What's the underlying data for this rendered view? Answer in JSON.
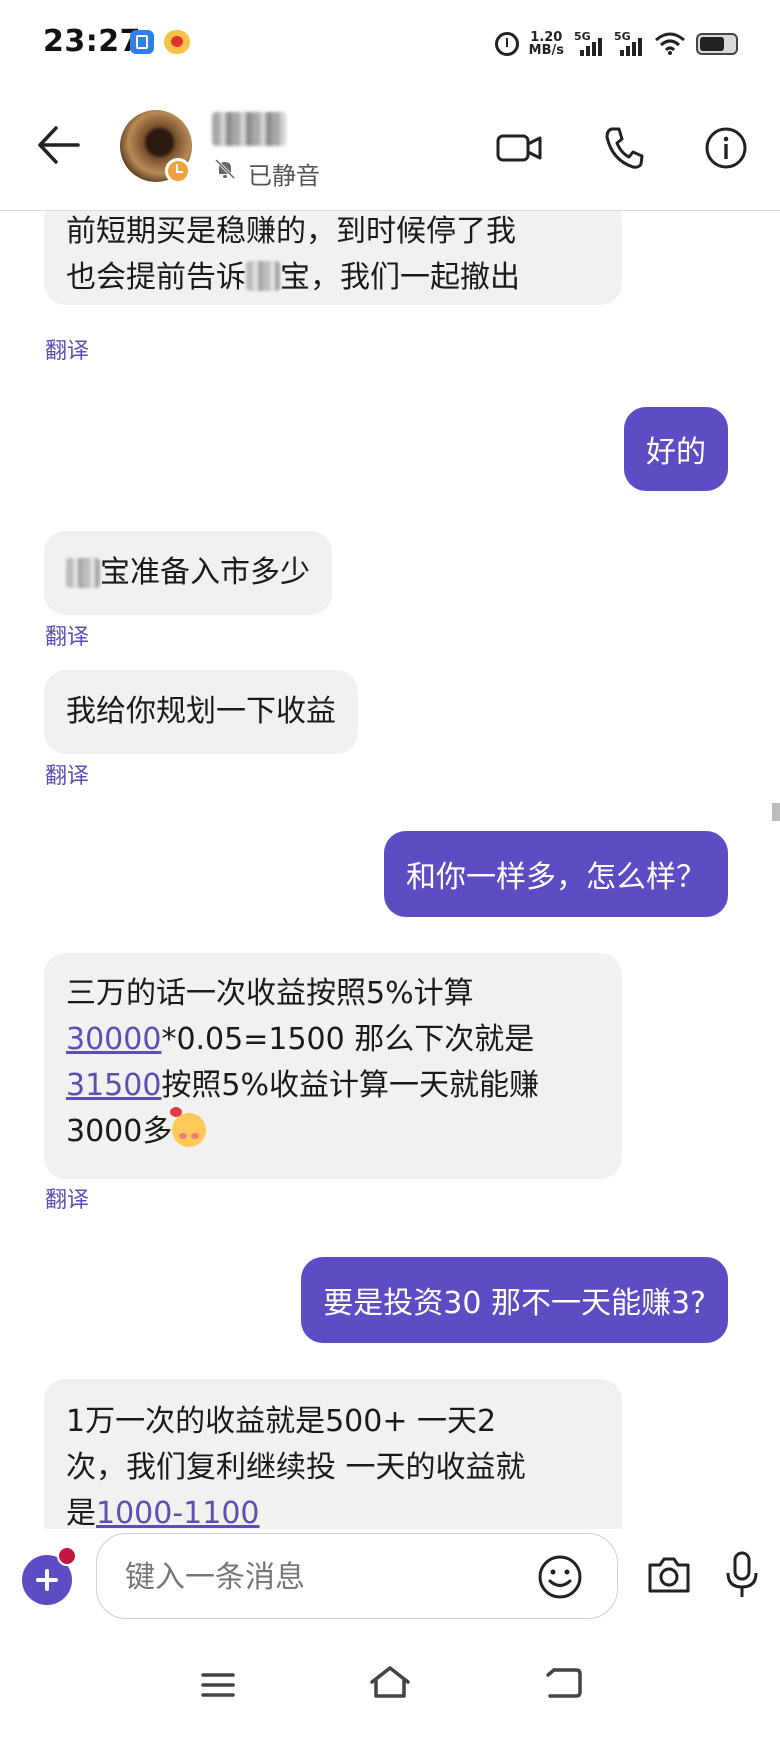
{
  "status_bar": {
    "time": "23:27",
    "speed_value": "1.20",
    "speed_unit": "MB/s",
    "signal1_label": "5G",
    "signal2_label": "5G",
    "icons": [
      "notes-app-icon",
      "weibo-icon",
      "alarm-icon",
      "signal-icon",
      "wifi-icon",
      "battery-icon"
    ]
  },
  "header": {
    "mute_label": "已静音",
    "icons": [
      "back-arrow-icon",
      "video-call-icon",
      "phone-icon",
      "info-icon"
    ]
  },
  "messages": {
    "m1_line1": "前短期买是稳赚的，到时候停了我",
    "m1_line2a": "也会提前告诉",
    "m1_line2b": "宝，我们一起撤出",
    "m2": "好的",
    "m3": "宝准备入市多少",
    "m4": "我给你规划一下收益",
    "m5": "和你一样多，怎么样？",
    "m6_line1": "三万的话一次收益按照5%计算",
    "m6_link1": "30000",
    "m6_line2": "*0.05=1500 那么下次就是",
    "m6_link2": "31500",
    "m6_line3": "按照5%收益计算一天就能赚",
    "m6_line4": "3000多",
    "m7": "要是投资30 那不一天能赚3?",
    "m8_line1": "1万一次的收益就是500+ 一天2",
    "m8_line2": "次，我们复利继续投 一天的收益就",
    "m8_line3": "是",
    "m8_link": "1000-1100",
    "translate": "翻译"
  },
  "composer": {
    "placeholder": "键入一条消息"
  },
  "colors": {
    "accent": "#5d4dc4",
    "link": "#5a4fb3",
    "incoming_bubble": "#f1f1f0",
    "badge": "#c4163f"
  }
}
